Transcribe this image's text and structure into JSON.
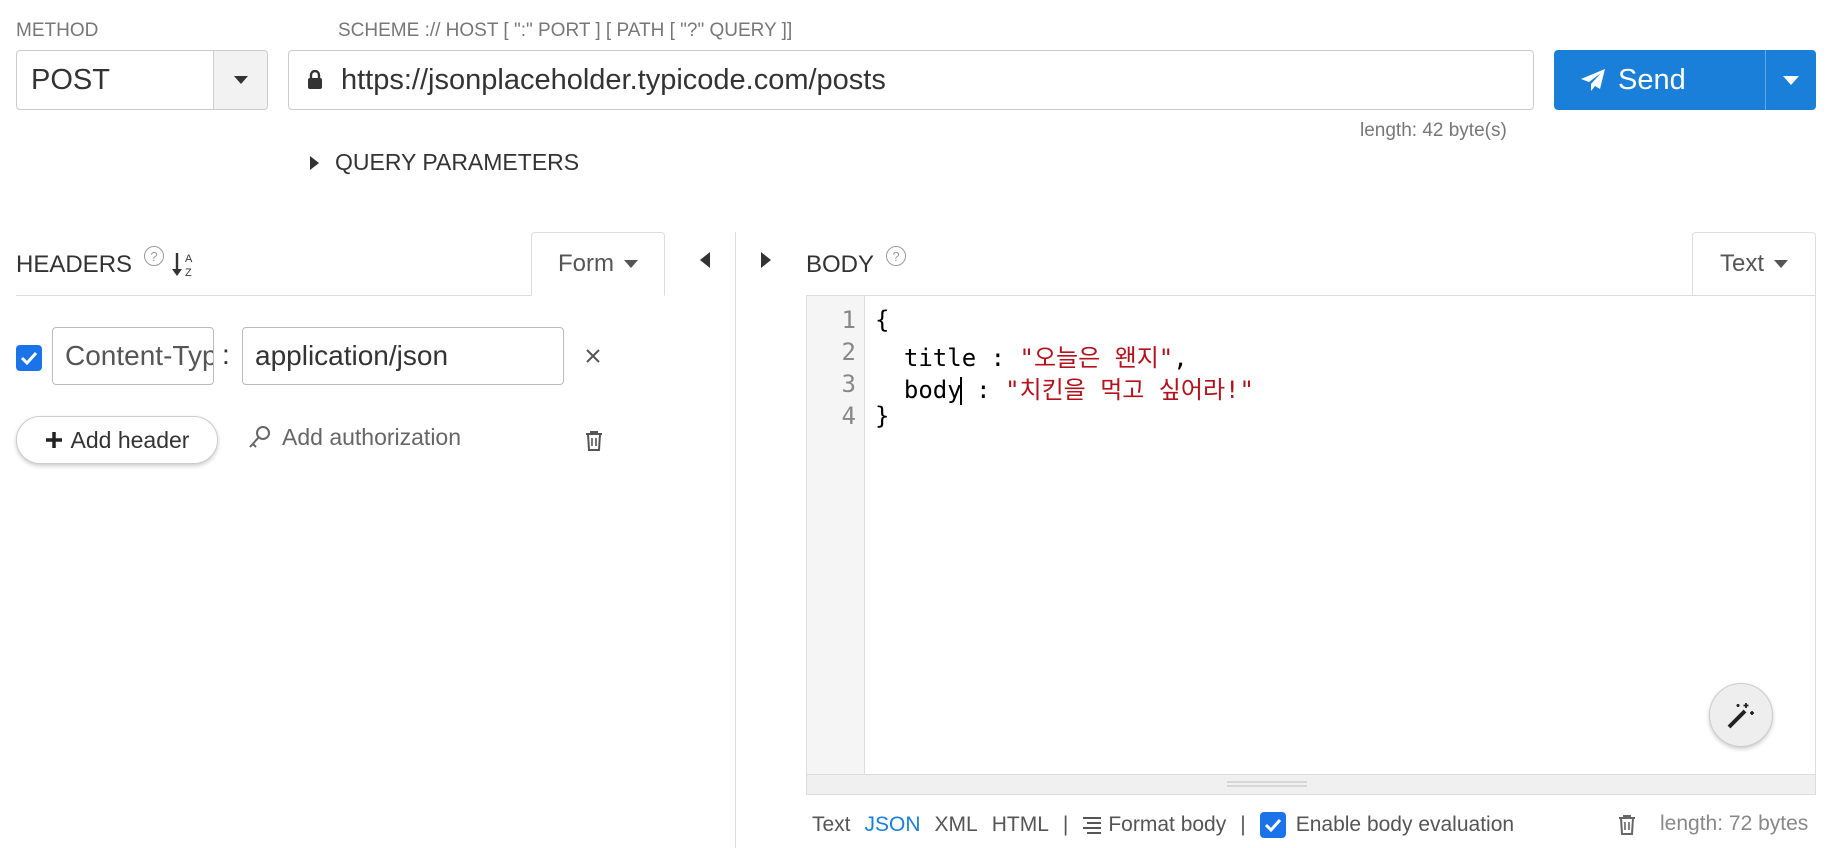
{
  "request": {
    "method_label": "METHOD",
    "method": "POST",
    "url_label": "SCHEME :// HOST [ \":\" PORT ] [ PATH [ \"?\" QUERY ]]",
    "url": "https://jsonplaceholder.typicode.com/posts",
    "url_length": "length: 42 byte(s)",
    "send_label": "Send",
    "query_params_label": "QUERY PARAMETERS"
  },
  "headers": {
    "title": "HEADERS",
    "help": "?",
    "mode": "Form",
    "items": [
      {
        "checked": true,
        "key": "Content-Type",
        "value": "application/json",
        "separator": ":"
      }
    ],
    "add_header_label": "Add header",
    "add_auth_label": "Add authorization"
  },
  "body": {
    "title": "BODY",
    "help": "?",
    "mode": "Text",
    "line_numbers": [
      "1",
      "2",
      "3",
      "4"
    ],
    "lines": {
      "l1": "{",
      "l2_key": "  title : ",
      "l2_val": "\"오늘은 왠지\"",
      "l2_end": ",",
      "l3_key": "  body",
      "l3_mid": " : ",
      "l3_val": "\"치킨을 먹고 싶어라!\"",
      "l4": "}"
    },
    "formats": [
      "Text",
      "JSON",
      "XML",
      "HTML"
    ],
    "active_format": "JSON",
    "format_body_label": "Format body",
    "enable_eval_label": "Enable body evaluation",
    "length": "length: 72 bytes"
  },
  "colors": {
    "accent": "#1a7fd9",
    "string": "#b3111b"
  }
}
